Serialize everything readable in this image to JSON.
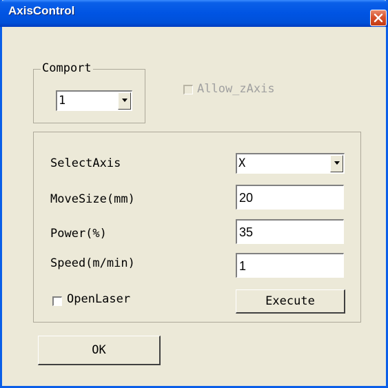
{
  "window": {
    "title": "AxisControl"
  },
  "comport": {
    "label": "Comport",
    "value": "1"
  },
  "allow_z": {
    "label": "Allow_zAxis",
    "checked": false,
    "enabled": false
  },
  "fields": {
    "select_axis": {
      "label": "SelectAxis",
      "value": "X"
    },
    "move_size": {
      "label": "MoveSize(mm)",
      "value": "20"
    },
    "power": {
      "label": "Power(%)",
      "value": "35"
    },
    "speed": {
      "label": "Speed(m/min)",
      "value": "1"
    }
  },
  "open_laser": {
    "label": "OpenLaser",
    "checked": false
  },
  "buttons": {
    "execute": "Execute",
    "ok": "OK"
  },
  "colors": {
    "titlebar": "#0054e3",
    "face": "#ece9d8",
    "close": "#d8522c",
    "disabled_text": "#a0a0a0"
  },
  "icons": {
    "close": "close-icon",
    "dropdown": "chevron-down-icon"
  }
}
